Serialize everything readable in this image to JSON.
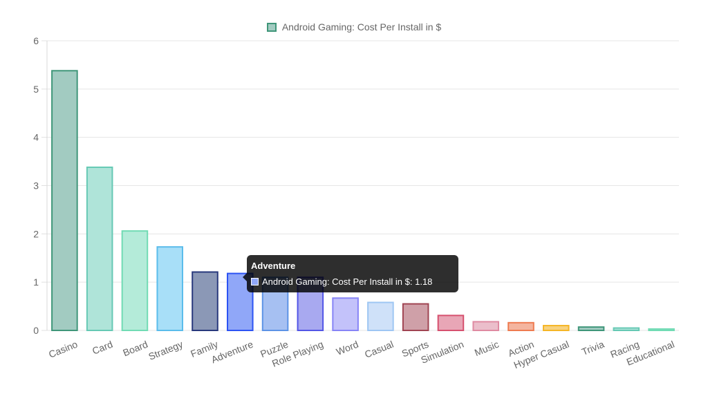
{
  "chart_data": {
    "type": "bar",
    "categories": [
      "Casino",
      "Card",
      "Board",
      "Strategy",
      "Family",
      "Adventure",
      "Puzzle",
      "Role Playing",
      "Word",
      "Casual",
      "Sports",
      "Simulation",
      "Music",
      "Action",
      "Hyper Casual",
      "Trivia",
      "Racing",
      "Educational"
    ],
    "series": [
      {
        "name": "Android Gaming: Cost Per Install in $",
        "values": [
          5.38,
          3.38,
          2.06,
          1.73,
          1.21,
          1.18,
          1.1,
          1.1,
          0.67,
          0.58,
          0.55,
          0.31,
          0.18,
          0.16,
          0.1,
          0.07,
          0.05,
          0.03
        ]
      }
    ],
    "bar_fill_colors": [
      "#a2cbc1",
      "#afe4d9",
      "#b4ebd9",
      "#a8dff8",
      "#8b98b6",
      "#90a7f8",
      "#a6c0f2",
      "#a8a9f0",
      "#c3c2fa",
      "#cfe1f9",
      "#cfa0a8",
      "#e8a6b6",
      "#ebbecb",
      "#f4b59f",
      "#f8d27e",
      "#a2cbc1",
      "#afe4d9",
      "#b4ebd9"
    ],
    "bar_border_colors": [
      "#3f9679",
      "#66c9b4",
      "#71dbb4",
      "#5abceb",
      "#27387c",
      "#2c53f3",
      "#5d93e6",
      "#5255e6",
      "#8784f6",
      "#9ec6f3",
      "#a04452",
      "#d6506e",
      "#df8aa2",
      "#ee7b50",
      "#f5b627",
      "#3f9679",
      "#66c9b4",
      "#71dbb4"
    ],
    "y_ticks": [
      "0",
      "1",
      "2",
      "3",
      "4",
      "5",
      "6"
    ],
    "ylim": [
      0,
      6
    ],
    "grid": true,
    "legend_position": "top-center",
    "title": "",
    "xlabel": "",
    "ylabel": ""
  },
  "legend": {
    "label": "Android Gaming: Cost Per Install in $",
    "fill": "#a2cbc1",
    "border": "#3f9679"
  },
  "tooltip": {
    "title": "Adventure",
    "label": "Android Gaming: Cost Per Install in $: 1.18",
    "swatch_color": "#90a7f8"
  }
}
